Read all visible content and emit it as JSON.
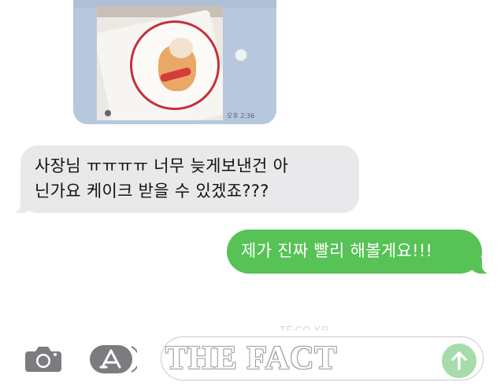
{
  "colors": {
    "incoming_bubble": "#e9e9eb",
    "outgoing_bubble": "#57c256",
    "image_bubble": "#b7c8dd",
    "send_button": "#a5dcaa"
  },
  "messages": [
    {
      "direction": "incoming",
      "type": "forwarded-screenshot",
      "image_caption": "cake photo with illustrated shiba dog and red ring",
      "time": "오후 2:36"
    },
    {
      "direction": "incoming",
      "type": "text",
      "lines": [
        "사장님 ㅠㅠㅠㅠ 너무 늦게보낸건 아",
        "닌가요 케이크 받을 수 있겠죠???"
      ]
    },
    {
      "direction": "outgoing",
      "type": "text",
      "text": "제가 진짜 빨리 해볼게요!!!"
    }
  ],
  "toolbar": {
    "camera_icon": "camera-icon",
    "appstore_icon": "app-store-icon",
    "send_icon": "arrow-up-icon",
    "input_value": ""
  },
  "watermark": {
    "url": "TF.CO.KR",
    "brand": "THE FACT"
  }
}
